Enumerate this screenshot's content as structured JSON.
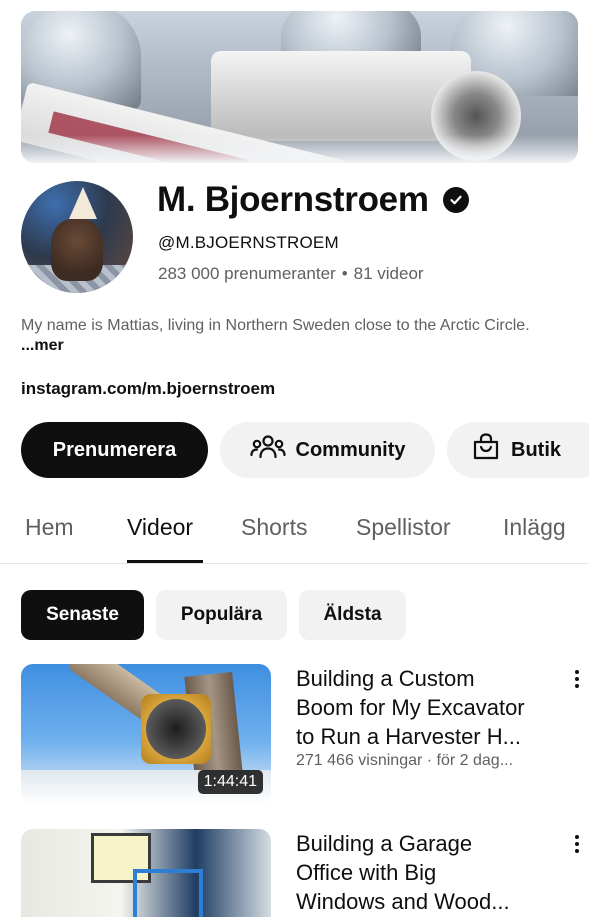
{
  "channel": {
    "name": "M. Bjoernstroem",
    "handle": "@M.BJOERNSTROEM",
    "subscribers": "283 000 prenumeranter",
    "separator": "•",
    "video_count": "81 videor",
    "description": "My name is Mattias, living in Northern Sweden close to the Arctic Circle.",
    "more_label": "...mer",
    "link": "instagram.com/m.bjoernstroem"
  },
  "actions": {
    "subscribe_label": "Prenumerera",
    "community_label": "Community",
    "community_icon": "people-group-icon",
    "shop_label": "Butik",
    "shop_icon": "shopping-bag-icon"
  },
  "tabs": [
    {
      "label": "Hem",
      "active": false
    },
    {
      "label": "Videor",
      "active": true
    },
    {
      "label": "Shorts",
      "active": false
    },
    {
      "label": "Spellistor",
      "active": false
    },
    {
      "label": "Inlägg",
      "active": false
    }
  ],
  "filters": [
    {
      "label": "Senaste",
      "active": true
    },
    {
      "label": "Populära",
      "active": false
    },
    {
      "label": "Äldsta",
      "active": false
    }
  ],
  "videos": [
    {
      "title_line1": "Building a Custom",
      "title_line2": "Boom for My Excavator",
      "title_line3": "to Run a Harvester H...",
      "meta": "271 466 visningar · för 2 dag...",
      "duration": "1:44:41"
    },
    {
      "title_line1": "Building a Garage",
      "title_line2": "Office with Big",
      "title_line3": "Windows and Wood..."
    }
  ],
  "colors": {
    "text_primary": "#0f0f0f",
    "text_secondary": "#606060",
    "chip_bg": "#f2f2f2",
    "subscribe_bg": "#0f0f0f"
  }
}
